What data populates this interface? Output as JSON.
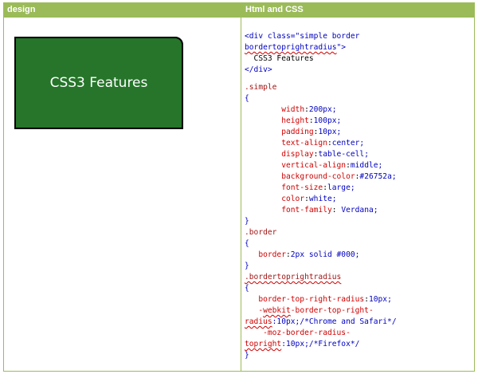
{
  "header": {
    "col1": "design",
    "col2": "Html and CSS"
  },
  "demo": {
    "text": "CSS3 Features"
  },
  "html_code": {
    "l1a": "<div class=\"simple border",
    "l2a": "bordertoprightradius",
    "l2b": "\">",
    "l3": "  CSS3 Features",
    "l4": "</div>"
  },
  "css_simple": {
    "selector": ".simple",
    "open": "{",
    "props": [
      {
        "p": "width",
        "v": "200px;"
      },
      {
        "p": "height",
        "v": "100px;"
      },
      {
        "p": "padding",
        "v": "10px;"
      },
      {
        "p": "text-align",
        "v": "center;"
      },
      {
        "p": "display",
        "v": "table-cell;"
      },
      {
        "p": "vertical-align",
        "v": "middle;"
      },
      {
        "p": "background-color",
        "v": "#26752a;"
      },
      {
        "p": "font-size",
        "v": "large;"
      },
      {
        "p": "color",
        "v": "white;"
      },
      {
        "p": "font-family",
        "v": " Verdana;"
      }
    ],
    "close": "}"
  },
  "css_border": {
    "selector": ".border",
    "open": "{",
    "prop": "border",
    "value": "2px solid #000;",
    "close": "}"
  },
  "css_radius": {
    "selector": ".bordertoprightradius",
    "open": "{",
    "l1p": "border-top-right-radius",
    "l1v": "10px;",
    "l2a": "-",
    "l2b": "webkit",
    "l2c": "-border-top-right-",
    "l3a": "radius",
    "l3b": ":10px;",
    "l3c": "/*Chrome and Safari*/",
    "l4": "-moz-border-radius-",
    "l5a": "topright",
    "l5b": ":10px;",
    "l5c": "/*Firefox*/",
    "close": "}"
  },
  "colors": {
    "header_bg": "#9bbb59",
    "demo_bg": "#26752a"
  }
}
